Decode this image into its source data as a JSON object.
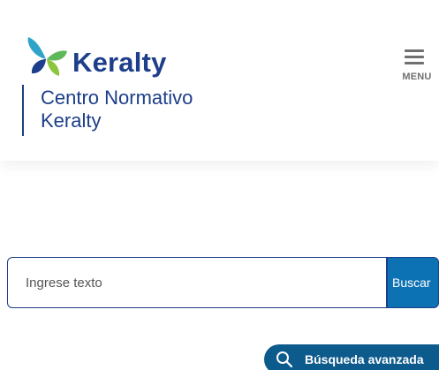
{
  "header": {
    "logo_text": "Keralty",
    "site_name_line1": "Centro Normativo",
    "site_name_line2": "Keralty",
    "menu_label": "MENU"
  },
  "search": {
    "placeholder": "Ingrese texto",
    "value": "",
    "button_label": "Buscar"
  },
  "advanced_search": {
    "label": "Búsqueda avanzada"
  },
  "colors": {
    "brand_blue": "#1d3e8a",
    "button_blue": "#0d72b4",
    "pill_blue": "#0d5a8c",
    "logo_green": "#5fb85a",
    "logo_teal": "#2fa4c8"
  }
}
